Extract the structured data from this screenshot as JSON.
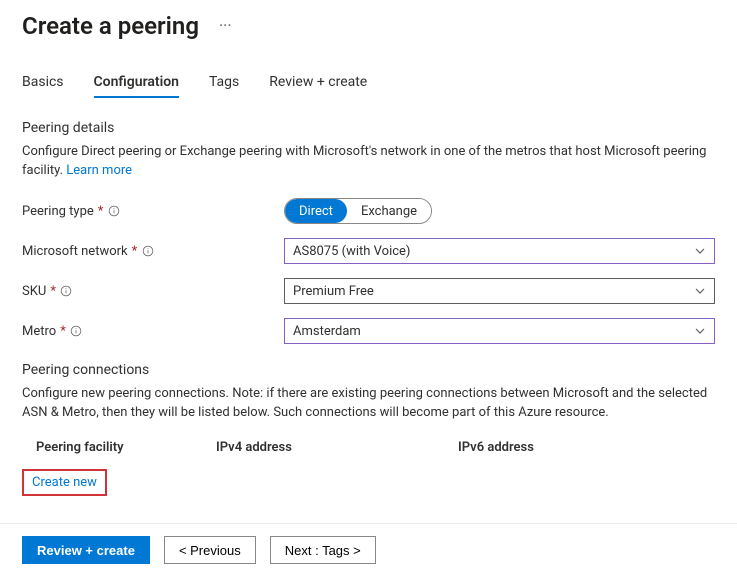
{
  "title": "Create a peering",
  "tabs": {
    "basics": "Basics",
    "configuration": "Configuration",
    "tags": "Tags",
    "review": "Review + create"
  },
  "details": {
    "heading": "Peering details",
    "desc_a": "Configure Direct peering or Exchange peering with Microsoft's network in one of the metros that host Microsoft peering facility. ",
    "learn_more": "Learn more"
  },
  "form": {
    "peering_type": {
      "label": "Peering type",
      "option_direct": "Direct",
      "option_exchange": "Exchange"
    },
    "ms_network": {
      "label": "Microsoft network",
      "value": "AS8075 (with Voice)"
    },
    "sku": {
      "label": "SKU",
      "value": "Premium Free"
    },
    "metro": {
      "label": "Metro",
      "value": "Amsterdam"
    }
  },
  "connections": {
    "heading": "Peering connections",
    "desc": "Configure new peering connections. Note: if there are existing peering connections between Microsoft and the selected ASN & Metro, then they will be listed below. Such connections will become part of this Azure resource.",
    "col_facility": "Peering facility",
    "col_ipv4": "IPv4 address",
    "col_ipv6": "IPv6 address",
    "create_new": "Create new"
  },
  "footer": {
    "review": "Review + create",
    "previous": "< Previous",
    "next": "Next : Tags >"
  }
}
